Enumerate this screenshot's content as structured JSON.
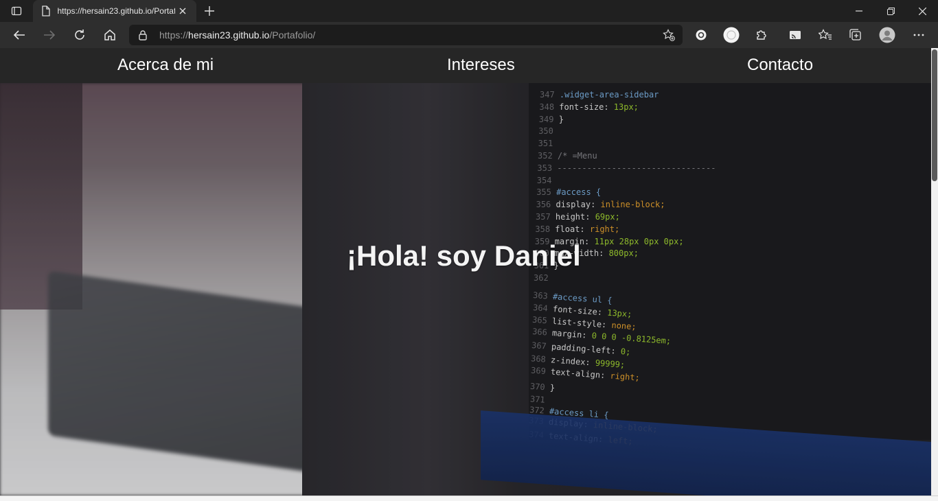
{
  "browser": {
    "tab": {
      "title": "https://hersain23.github.io/Portafolio/",
      "favicon": "page-icon"
    },
    "address": {
      "scheme": "https://",
      "host": "hersain23.github.io",
      "path": "/Portafolio/"
    },
    "icons": {
      "tab_actions": "tab-actions-icon",
      "new_tab": "plus-icon",
      "back": "back-arrow-icon",
      "forward": "forward-arrow-icon",
      "refresh": "refresh-icon",
      "home": "home-icon",
      "lock": "lock-icon",
      "favorite_add": "star-plus-icon",
      "extensions": "puzzle-icon",
      "favorites": "favorites-icon",
      "collections": "collections-icon",
      "profile": "profile-avatar",
      "more": "ellipsis-icon"
    }
  },
  "nav": {
    "items": [
      {
        "label": "Acerca de mi"
      },
      {
        "label": "Intereses"
      },
      {
        "label": "Contacto"
      }
    ]
  },
  "hero": {
    "title": "¡Hola! soy Daniel"
  },
  "code_snippet": {
    "lines": [
      {
        "n": "347",
        "text": ".widget-area-sidebar"
      },
      {
        "n": "348",
        "text": "    font-size: 13px;"
      },
      {
        "n": "349",
        "text": "}"
      },
      {
        "n": "350",
        "text": ""
      },
      {
        "n": "351",
        "text": ""
      },
      {
        "n": "352",
        "text": "/* =Menu"
      },
      {
        "n": "353",
        "text": "--------------------------------"
      },
      {
        "n": "354",
        "text": ""
      },
      {
        "n": "355",
        "text": "#access {"
      },
      {
        "n": "356",
        "text": "    display: inline-block;"
      },
      {
        "n": "357",
        "text": "    height: 69px;"
      },
      {
        "n": "358",
        "text": "    float: right;"
      },
      {
        "n": "359",
        "text": "    margin: 11px 28px 0px 0px;"
      },
      {
        "n": "360",
        "text": "    max-width: 800px;"
      },
      {
        "n": "361",
        "text": "}"
      },
      {
        "n": "362",
        "text": ""
      },
      {
        "n": "363",
        "text": "#access ul {"
      },
      {
        "n": "364",
        "text": "    font-size: 13px;"
      },
      {
        "n": "365",
        "text": "    list-style: none;"
      },
      {
        "n": "366",
        "text": "    margin: 0 0 0 -0.8125em;"
      },
      {
        "n": "367",
        "text": "    padding-left: 0;"
      },
      {
        "n": "368",
        "text": "    z-index: 99999;"
      },
      {
        "n": "369",
        "text": "    text-align: right;"
      },
      {
        "n": "370",
        "text": "}"
      },
      {
        "n": "371",
        "text": ""
      },
      {
        "n": "372",
        "text": "#access li {"
      },
      {
        "n": "373",
        "text": "    display: inline-block;"
      },
      {
        "n": "374",
        "text": "    text-align: left;"
      }
    ]
  },
  "colors": {
    "chrome_bg": "#202020",
    "toolbar_bg": "#2e2e2e",
    "nav_bg": "#262626",
    "code_selector": "#7eb6e8",
    "code_property": "#e8e8e8",
    "code_value": "#a6d933",
    "code_keyword": "#f0a830"
  }
}
